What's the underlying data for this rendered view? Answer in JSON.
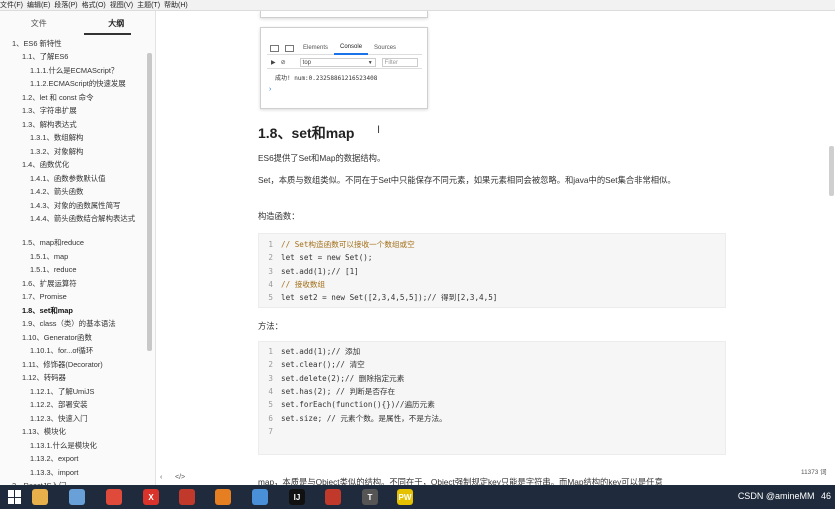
{
  "menubar": {
    "items": [
      "文件(F)",
      "编辑(E)",
      "段落(P)",
      "格式(O)",
      "视图(V)",
      "主题(T)",
      "帮助(H)"
    ]
  },
  "sidebar": {
    "tabs": [
      "文件",
      "大纲"
    ],
    "active_tab": "大纲",
    "toc": [
      "1、ES6 新特性",
      "1.1、了解ES6",
      "1.1.1.什么是ECMAScript？",
      "1.1.2.ECMAScript的快速发展",
      "1.2、let 和 const 命令",
      "1.3、字符串扩展",
      "1.3、解构表达式",
      "1.3.1、数组解构",
      "1.3.2、对象解构",
      "1.4、函数优化",
      "1.4.1、函数参数默认值",
      "1.4.2、箭头函数",
      "1.4.3、对象的函数属性简写",
      "1.4.4、箭头函数结合解构表达式",
      "1.5、map和reduce",
      "1.5.1、map",
      "1.5.1、reduce",
      "1.6、扩展运算符",
      "1.7、Promise",
      "1.8、set和map",
      "1.9、class（类）的基本语法",
      "1.10、Generator函数",
      "1.10.1、for...of循环",
      "1.11、修饰器(Decorator)",
      "1.12、转码器",
      "1.12.1、了解UmiJS",
      "1.12.2、部署安装",
      "1.12.3、快速入门",
      "1.13、模块化",
      "1.13.1.什么是模块化",
      "1.13.2、export",
      "1.13.3、import",
      "2、ReactJS入门"
    ]
  },
  "devtools": {
    "tabs": [
      "Elements",
      "Console",
      "Sources"
    ],
    "active_tab": "Console",
    "context": "top",
    "filter_placeholder": "Filter",
    "output": "成功! num:0.23258861216523408",
    "prompt": "›"
  },
  "content": {
    "heading": "1.8、set和map",
    "cursor": "I",
    "intro": "ES6提供了Set和Map的数据结构。",
    "set_desc": "Set，本质与数组类似。不同在于Set中只能保存不同元素，如果元素相同会被忽略。和java中的Set集合非常相似。",
    "ctor_label": "构造函数：",
    "methods_label": "方法：",
    "map_desc": "map，本质是与Object类似的结构。不同在于，Object强制规定key只能是字符串。而Map结构的key可以是任意"
  },
  "code1": [
    "// Set构造函数可以接收一个数组或空",
    "let set = new Set();",
    "set.add(1);// [1]",
    "// 接收数组",
    "let set2 = new Set([2,3,4,5,5]);// 得到[2,3,4,5]"
  ],
  "code2": [
    "set.add(1);// 添加",
    "set.clear();// 清空",
    "set.delete(2);// 删除指定元素",
    "set.has(2); // 判断是否存在",
    "set.forEach(function(){})//遍历元素",
    "set.size; // 元素个数。是属性，不是方法。",
    ""
  ],
  "statusbar": {
    "word_count": "11373 词",
    "left_icon": "‹",
    "code_icon": "</>"
  },
  "taskbar": {
    "apps": [
      {
        "name": "file-explorer",
        "label": "",
        "color": "#e8b04a"
      },
      {
        "name": "paint",
        "label": "",
        "color": "#6aa0d8"
      },
      {
        "name": "chrome",
        "label": "",
        "color": "#e04a3a"
      },
      {
        "name": "xmind",
        "label": "X",
        "color": "#d9332b"
      },
      {
        "name": "books",
        "label": "",
        "color": "#c0392b"
      },
      {
        "name": "slides",
        "label": "",
        "color": "#e67e22"
      },
      {
        "name": "grid-app",
        "label": "",
        "color": "#4a90d9"
      },
      {
        "name": "intellij",
        "label": "IJ",
        "color": "#111111"
      },
      {
        "name": "house-app",
        "label": "",
        "color": "#c0392b"
      },
      {
        "name": "typora",
        "label": "T",
        "color": "#555555"
      },
      {
        "name": "pwa-app",
        "label": "PW",
        "color": "#e5c100"
      }
    ],
    "tray": "CSDN @amineMM",
    "tray_num": "46"
  }
}
